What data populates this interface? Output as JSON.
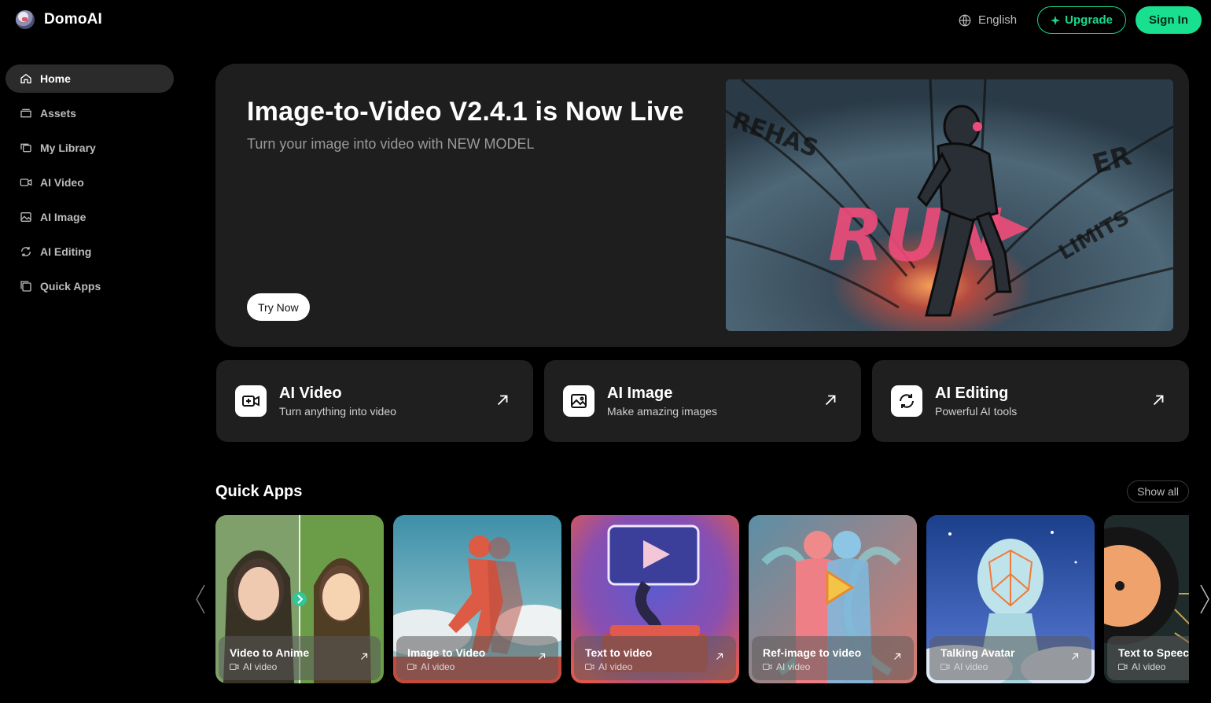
{
  "header": {
    "brand": "DomoAI",
    "language": "English",
    "upgrade_label": "Upgrade",
    "signin_label": "Sign In"
  },
  "sidebar": {
    "items": [
      {
        "label": "Home",
        "icon": "home-icon",
        "active": true
      },
      {
        "label": "Assets",
        "icon": "assets-icon"
      },
      {
        "label": "My Library",
        "icon": "library-icon"
      },
      {
        "label": "AI Video",
        "icon": "video-icon"
      },
      {
        "label": "AI Image",
        "icon": "image-icon"
      },
      {
        "label": "AI Editing",
        "icon": "editing-icon"
      },
      {
        "label": "Quick Apps",
        "icon": "apps-icon"
      }
    ]
  },
  "hero": {
    "title": "Image-to-Video V2.4.1 is Now Live",
    "subtitle": "Turn your image into video with NEW MODEL",
    "cta": "Try Now",
    "banner_text": "RUN"
  },
  "features": [
    {
      "title": "AI Video",
      "subtitle": "Turn anything into video",
      "icon": "video-camera-icon"
    },
    {
      "title": "AI Image",
      "subtitle": "Make amazing images",
      "icon": "picture-icon"
    },
    {
      "title": "AI Editing",
      "subtitle": "Powerful AI tools",
      "icon": "editing-icon"
    }
  ],
  "quick_apps": {
    "title": "Quick Apps",
    "show_all": "Show all",
    "cards": [
      {
        "title": "Video to Anime",
        "tag": "AI video"
      },
      {
        "title": "Image to Video",
        "tag": "AI video"
      },
      {
        "title": "Text to video",
        "tag": "AI video"
      },
      {
        "title": "Ref-image to video",
        "tag": "AI video"
      },
      {
        "title": "Talking Avatar",
        "tag": "AI video"
      },
      {
        "title": "Text to Speech",
        "tag": "AI video"
      }
    ]
  },
  "colors": {
    "accent": "#19e08f",
    "background": "#000000",
    "card": "#1f1f1f"
  }
}
